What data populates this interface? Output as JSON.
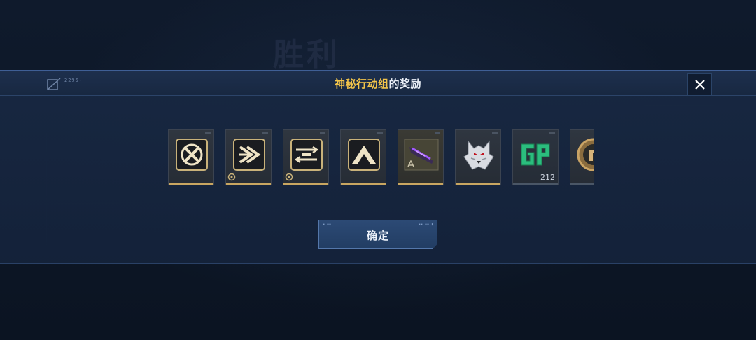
{
  "background": {
    "title": "胜利"
  },
  "modal": {
    "logo_code": "2295-",
    "title_highlight": "神秘行动组",
    "title_rest": "的奖励"
  },
  "rewards": [
    {
      "name": "skill-cross-icon",
      "type": "emblem"
    },
    {
      "name": "skill-arrow-icon",
      "type": "emblem"
    },
    {
      "name": "skill-rifle-icon",
      "type": "emblem"
    },
    {
      "name": "skill-peak-icon",
      "type": "emblem"
    },
    {
      "name": "purple-weapon-skin-icon",
      "type": "weapon"
    },
    {
      "name": "wolf-avatar-icon",
      "type": "avatar"
    },
    {
      "name": "gp-currency-icon",
      "type": "currency",
      "count": "212"
    },
    {
      "name": "gold-coin-icon",
      "type": "currency"
    }
  ],
  "confirm_button": {
    "label": "确定"
  },
  "colors": {
    "accent_gold": "#f3c54a",
    "card_gold_bar": "#c9a661",
    "button_blue": "#2c4a75"
  }
}
